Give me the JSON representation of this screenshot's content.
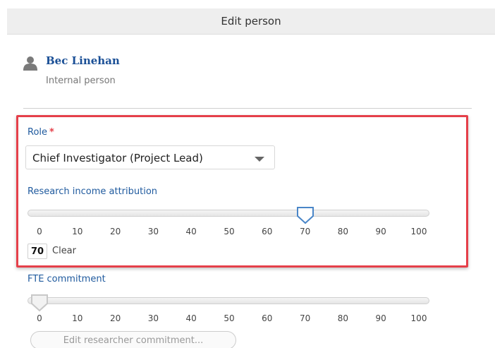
{
  "dialog": {
    "title": "Edit person"
  },
  "person": {
    "name": "Bec Linehan",
    "type": "Internal person",
    "icon": "person-icon"
  },
  "role": {
    "label": "Role",
    "required_marker": "*",
    "selected": "Chief Investigator (Project Lead)"
  },
  "research_income": {
    "label": "Research income attribution",
    "value": 70,
    "value_text": "70",
    "clear_label": "Clear",
    "ticks": [
      "0",
      "10",
      "20",
      "30",
      "40",
      "50",
      "60",
      "70",
      "80",
      "90",
      "100"
    ]
  },
  "fte": {
    "label": "FTE commitment",
    "value": 0,
    "ticks": [
      "0",
      "10",
      "20",
      "30",
      "40",
      "50",
      "60",
      "70",
      "80",
      "90",
      "100"
    ],
    "edit_button": "Edit researcher commitment..."
  },
  "colors": {
    "highlight": "#e5404a",
    "label": "#1f5a9e",
    "name": "#1a4f96"
  }
}
